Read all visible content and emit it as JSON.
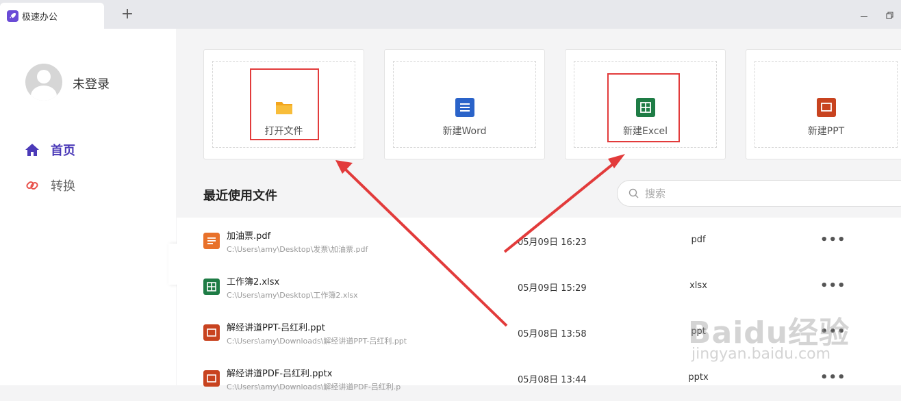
{
  "app": {
    "tab_title": "极速办公",
    "new_tab": "+"
  },
  "colors": {
    "accent": "#4b3ab8",
    "pdf": "#e8712a",
    "word": "#2a63c9",
    "excel": "#1e7c45",
    "ppt": "#c8431f",
    "annotation": "#e23b3b"
  },
  "user": {
    "name": "未登录"
  },
  "nav": [
    {
      "label": "首页",
      "icon": "home-icon",
      "active": true
    },
    {
      "label": "转换",
      "icon": "link-icon",
      "active": false
    }
  ],
  "actions": [
    {
      "label": "打开文件",
      "icon": "folder-icon",
      "highlighted": true
    },
    {
      "label": "新建Word",
      "icon": "word-icon",
      "highlighted": false
    },
    {
      "label": "新建Excel",
      "icon": "excel-icon",
      "highlighted": true
    },
    {
      "label": "新建PPT",
      "icon": "ppt-icon",
      "highlighted": false
    }
  ],
  "recent": {
    "title": "最近使用文件",
    "search_placeholder": "搜索",
    "more_label": "•••",
    "files": [
      {
        "name": "加油票.pdf",
        "path": "C:\\Users\\amy\\Desktop\\发票\\加油票.pdf",
        "date": "05月09日 16:23",
        "type": "pdf",
        "icon": "pdf-icon"
      },
      {
        "name": "工作簿2.xlsx",
        "path": "C:\\Users\\amy\\Desktop\\工作簿2.xlsx",
        "date": "05月09日 15:29",
        "type": "xlsx",
        "icon": "excel-icon"
      },
      {
        "name": "解经讲道PPT-吕红利.ppt",
        "path": "C:\\Users\\amy\\Downloads\\解经讲道PPT-吕红利.ppt",
        "date": "05月08日 13:58",
        "type": "ppt",
        "icon": "ppt-icon"
      },
      {
        "name": "解经讲道PDF-吕红利.pptx",
        "path": "C:\\Users\\amy\\Downloads\\解经讲道PDF-吕红利.p",
        "date": "05月08日 13:44",
        "type": "pptx",
        "icon": "ppt-icon"
      }
    ]
  },
  "watermark": {
    "main": "Baidu经验",
    "sub": "jingyan.baidu.com"
  }
}
